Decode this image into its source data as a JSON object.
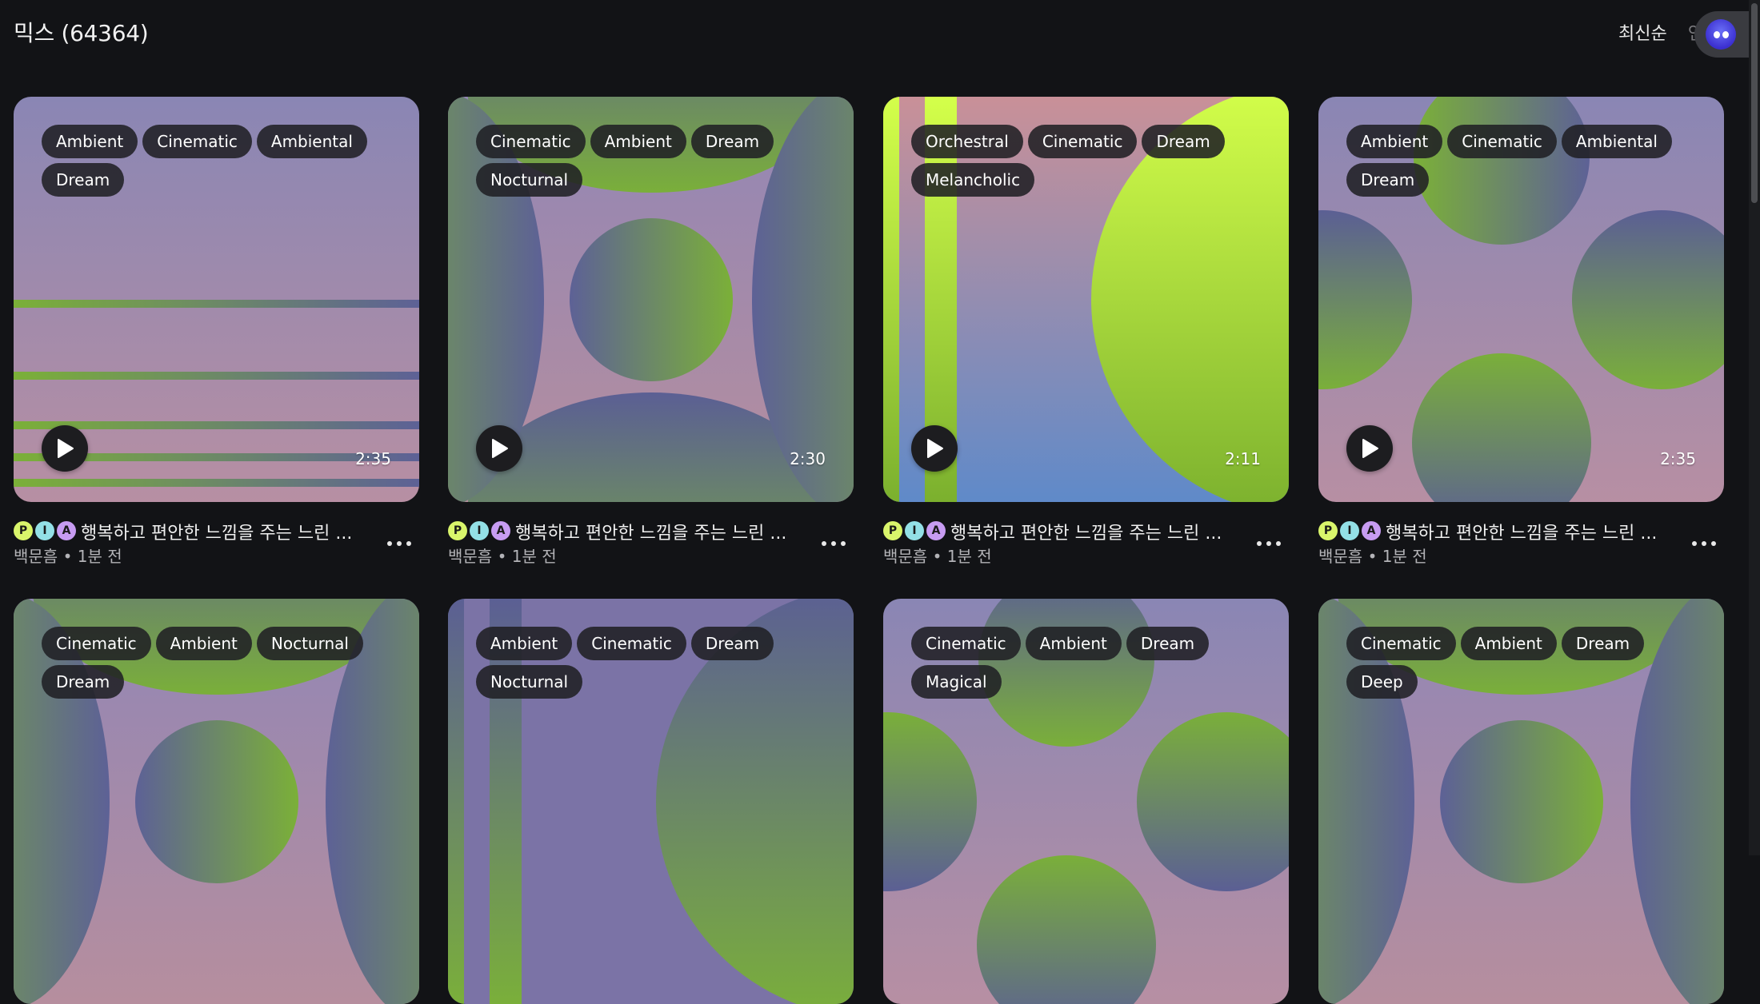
{
  "header": {
    "title": "믹스 (64364)",
    "sort_options": [
      "최신순",
      "인"
    ]
  },
  "cards": [
    {
      "tags": [
        "Ambient",
        "Cinematic",
        "Ambiental",
        "Dream"
      ],
      "duration": "2:35",
      "title": "행복하고 편안한 느낌을 주는 느린 ...",
      "author": "백문흠",
      "time": "• 1분 전",
      "badges": [
        "P",
        "I",
        "A"
      ]
    },
    {
      "tags": [
        "Cinematic",
        "Ambient",
        "Dream",
        "Nocturnal"
      ],
      "duration": "2:30",
      "title": "행복하고 편안한 느낌을 주는 느린 ...",
      "author": "백문흠",
      "time": "• 1분 전",
      "badges": [
        "P",
        "I",
        "A"
      ]
    },
    {
      "tags": [
        "Orchestral",
        "Cinematic",
        "Dream",
        "Melancholic"
      ],
      "duration": "2:11",
      "title": "행복하고 편안한 느낌을 주는 느린 ...",
      "author": "백문흠",
      "time": "• 1분 전",
      "badges": [
        "P",
        "I",
        "A"
      ]
    },
    {
      "tags": [
        "Ambient",
        "Cinematic",
        "Ambiental",
        "Dream"
      ],
      "duration": "2:35",
      "title": "행복하고 편안한 느낌을 주는 느린 ...",
      "author": "백문흠",
      "time": "• 1분 전",
      "badges": [
        "P",
        "I",
        "A"
      ]
    },
    {
      "tags": [
        "Cinematic",
        "Ambient",
        "Nocturnal",
        "Dream"
      ],
      "duration": "",
      "title": "",
      "author": "",
      "time": "",
      "badges": []
    },
    {
      "tags": [
        "Ambient",
        "Cinematic",
        "Dream",
        "Nocturnal"
      ],
      "duration": "",
      "title": "",
      "author": "",
      "time": "",
      "badges": []
    },
    {
      "tags": [
        "Cinematic",
        "Ambient",
        "Dream",
        "Magical"
      ],
      "duration": "",
      "title": "",
      "author": "",
      "time": "",
      "badges": []
    },
    {
      "tags": [
        "Cinematic",
        "Ambient",
        "Dream",
        "Deep"
      ],
      "duration": "",
      "title": "",
      "author": "",
      "time": "",
      "badges": []
    }
  ],
  "icons": {
    "play": "play-icon",
    "more": "more-horizontal-icon",
    "assistant": "assistant-bot-icon"
  }
}
